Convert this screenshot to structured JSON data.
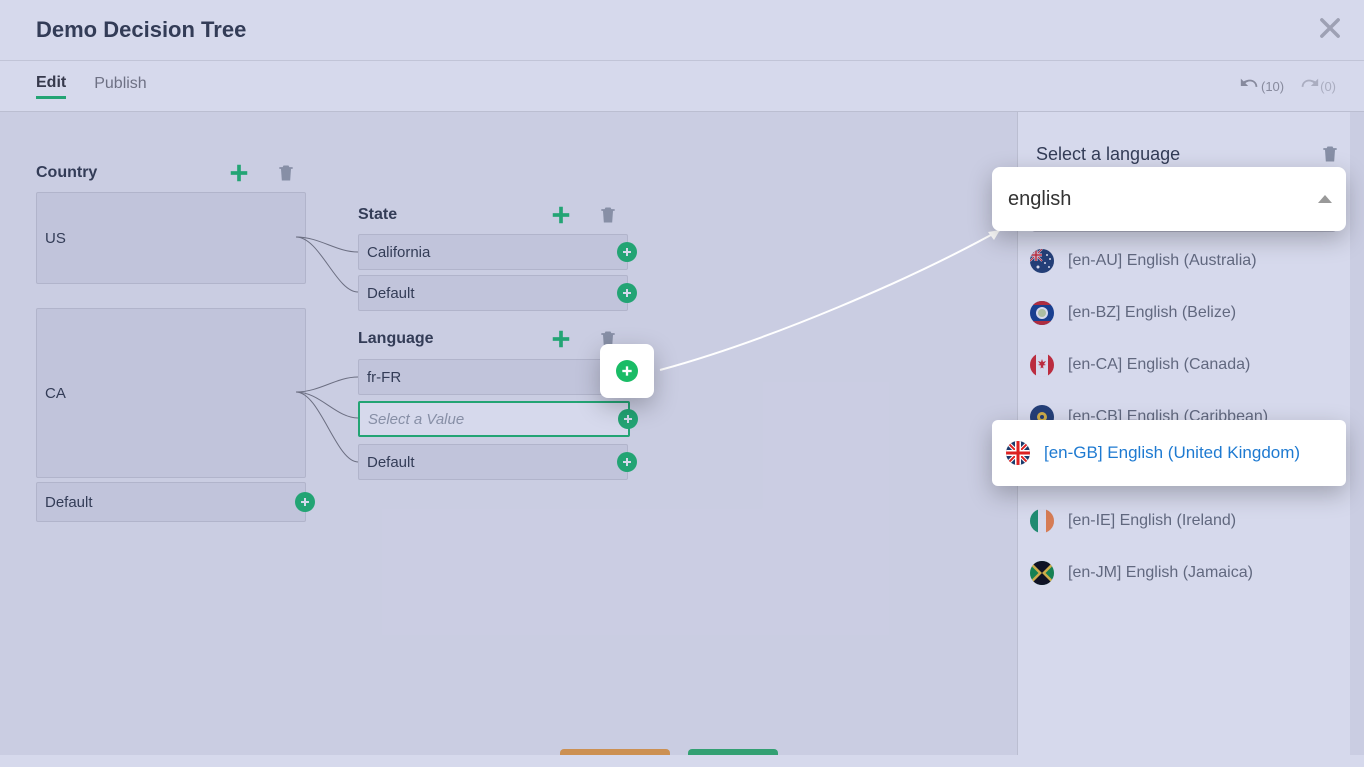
{
  "header": {
    "title": "Demo Decision Tree"
  },
  "tabs": {
    "edit": "Edit",
    "publish": "Publish"
  },
  "undo": {
    "count": "(10)"
  },
  "redo": {
    "count": "(0)"
  },
  "tree": {
    "col1": {
      "title": "Country",
      "us": "US",
      "ca": "CA",
      "default": "Default"
    },
    "col2a": {
      "title": "State",
      "california": "California",
      "default": "Default"
    },
    "col2b": {
      "title": "Language",
      "fr": "fr-FR",
      "select_placeholder": "Select a Value",
      "default": "Default"
    }
  },
  "panel": {
    "label": "Select a language",
    "search_value": "english",
    "options": [
      {
        "code": "en-AU",
        "label": "[en-AU] English (Australia)"
      },
      {
        "code": "en-BZ",
        "label": "[en-BZ] English (Belize)"
      },
      {
        "code": "en-CA",
        "label": "[en-CA] English (Canada)"
      },
      {
        "code": "en-CB",
        "label": "[en-CB] English (Caribbean)"
      },
      {
        "code": "en-GB",
        "label": "[en-GB] English (United Kingdom)"
      },
      {
        "code": "en-IE",
        "label": "[en-IE] English (Ireland)"
      },
      {
        "code": "en-JM",
        "label": "[en-JM] English (Jamaica)"
      }
    ]
  }
}
